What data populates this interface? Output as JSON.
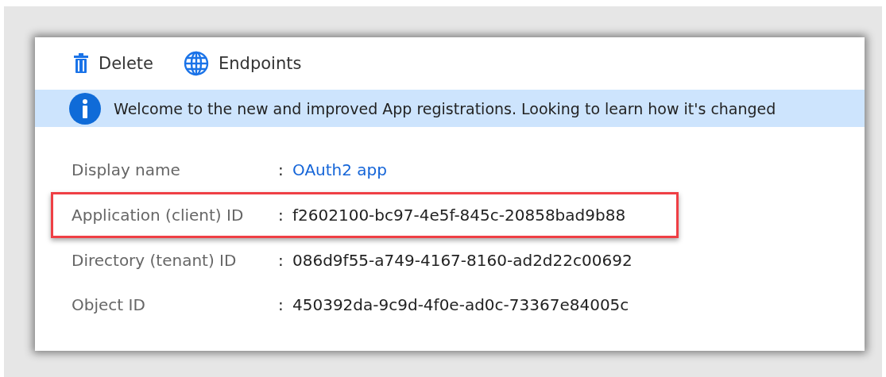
{
  "toolbar": [
    {
      "kind": "delete",
      "label": "Delete"
    },
    {
      "kind": "endpoints",
      "label": "Endpoints"
    }
  ],
  "banner": {
    "text": "Welcome to the new and improved App registrations. Looking to learn how it's changed"
  },
  "properties": [
    {
      "label": "Display name",
      "separator": ":",
      "value": "OAuth2 app",
      "kind": "link",
      "highlighted": false
    },
    {
      "label": "Application (client) ID",
      "separator": ":",
      "value": "f2602100-bc97-4e5f-845c-20858bad9b88",
      "kind": "text",
      "highlighted": true
    },
    {
      "label": "Directory (tenant) ID",
      "separator": ":",
      "value": "086d9f55-a749-4167-8160-ad2d22c00692",
      "kind": "text",
      "highlighted": false
    },
    {
      "label": "Object ID",
      "separator": ":",
      "value": "450392da-9c9d-4f0e-ad0c-73367e84005c",
      "kind": "text",
      "highlighted": false
    }
  ]
}
